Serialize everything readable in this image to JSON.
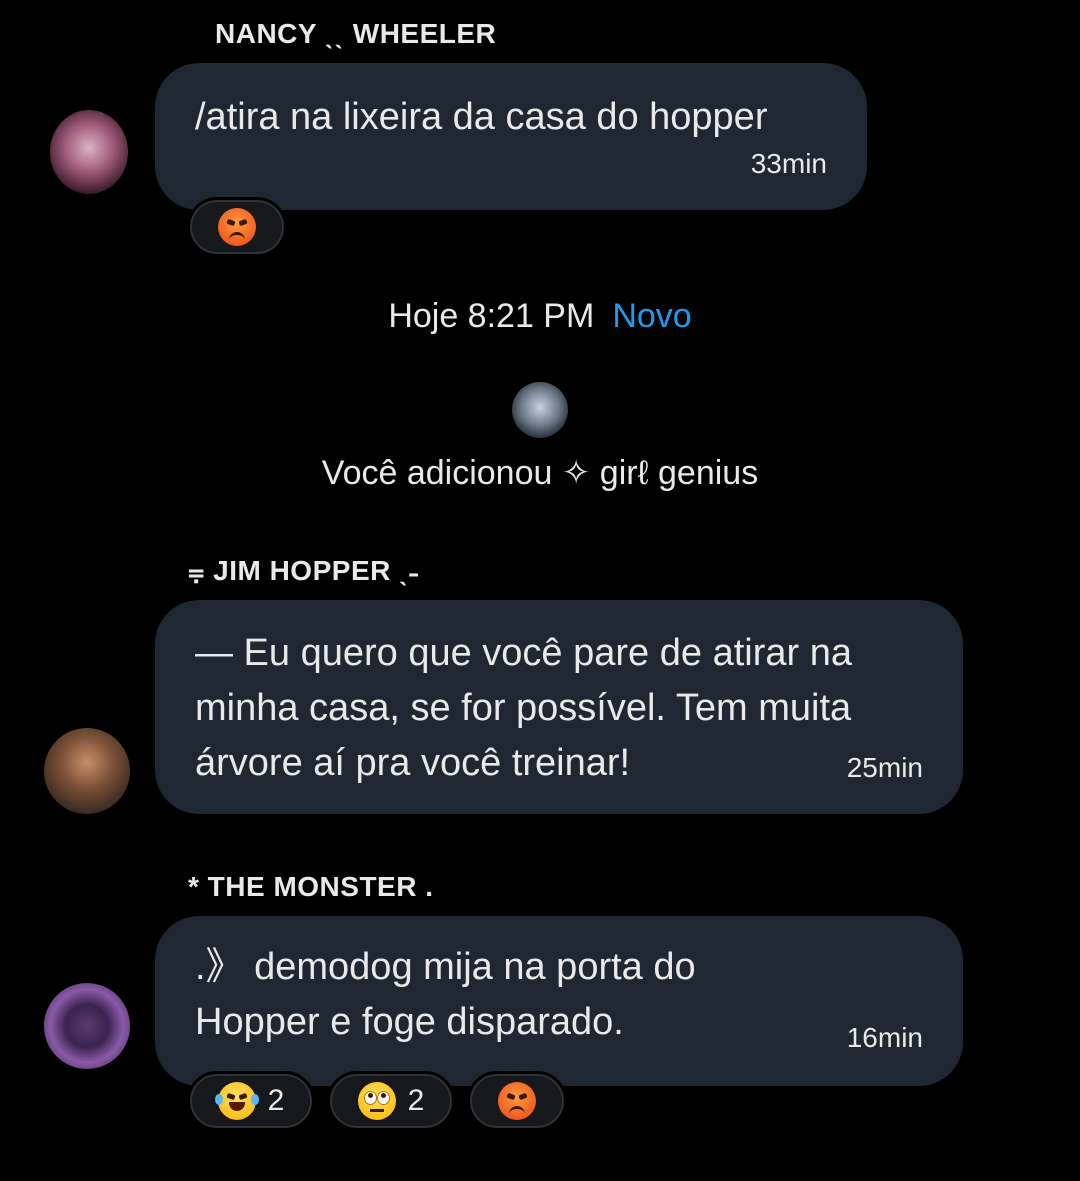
{
  "messages": [
    {
      "sender": "NANCY ˎˎ WHEELER",
      "text": "/atira na lixeira da casa do hopper",
      "time": "33min"
    },
    {
      "sender": "⩦ JIM HOPPER ˎ˗",
      "text_lines": [
        "— Eu quero que você pare de atirar na",
        "minha casa, se for possível. Tem muita",
        "árvore aí pra você treinar!"
      ],
      "time": "25min"
    },
    {
      "sender": "* THE MONSTER .",
      "text_lines": [
        ".》  demodog  mija  na  porta  do",
        "Hopper  e  foge  disparado."
      ],
      "time": "16min"
    }
  ],
  "divider": {
    "time": "Hoje 8:21 PM",
    "new_label": "Novo"
  },
  "system_event": {
    "text": "Você adicionou ✧ girℓ genius"
  },
  "reactions": {
    "msg1": [
      {
        "icon": "angry-face-emoji"
      }
    ],
    "msg3": [
      {
        "icon": "tears-of-joy-emoji",
        "count": "2"
      },
      {
        "icon": "eye-roll-emoji",
        "count": "2"
      },
      {
        "icon": "angry-face-emoji"
      }
    ]
  },
  "colors": {
    "background": "#000000",
    "bubble": "#1e2732",
    "accent": "#1d9bf0",
    "text": "#e7e9ea"
  }
}
